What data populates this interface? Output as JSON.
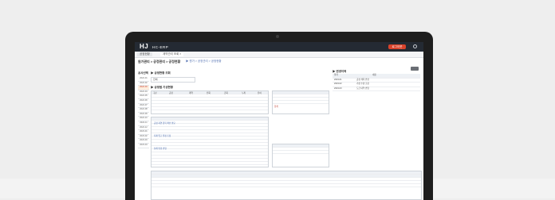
{
  "app": {
    "logo_text": "HJ",
    "logo_accent": "J",
    "system_name": "HC-ERP",
    "nav": [
      "기준정보",
      "인사/급여",
      "영업관리",
      "공사",
      "구매/자재",
      "원가관리",
      "공통",
      "시스템"
    ],
    "active_nav_index": 5,
    "user_button": "로그아웃"
  },
  "tabs": [
    "공정현황",
    "계약관리 조회 ×"
  ],
  "page": {
    "title": "원가관리 > 공정관리 > 공정현황",
    "breadcrumb": "▶ 원가 > 공정관리 > 공정현황"
  },
  "left_panel": {
    "header": "공사선택",
    "items": [
      "2022-01",
      "2022-02",
      "2022-03",
      "2022-04",
      "2022-05",
      "2022-06",
      "2022-07",
      "2022-08",
      "2022-09",
      "2022-10",
      "2022-11",
      "2022-12",
      "2023-01",
      "2023-02",
      "2023-03",
      "2023-04"
    ],
    "selected_index": 2
  },
  "main": {
    "section_title": "▶ 공정현황 조회",
    "filter_value": "전체",
    "sub_title": "▶ 공정별 기성현황",
    "grid_headers": [
      "구분",
      "공정",
      "계약",
      "전회",
      "금회",
      "누계",
      "잔여"
    ],
    "summary_label": "합계",
    "notes": [
      "공정 지연 항목 확인 필요",
      "자재 입고 일정 조정",
      "설계 변경 반영"
    ]
  },
  "right_panel": {
    "header": "▶ 변경이력",
    "columns": [
      "일자",
      "내용"
    ],
    "rows": [
      {
        "date": "2023-01",
        "text": "공정 계획 변경"
      },
      {
        "date": "2023-02",
        "text": "기성 수량 조정"
      },
      {
        "date": "2023-03",
        "text": "도급 내역 반영"
      }
    ]
  },
  "colors": {
    "topbar": "#242a33",
    "accent": "#d9432b",
    "selected_row": "#ffeede",
    "laptop_bezel": "#1e1e1e",
    "background": "#eeeeee"
  },
  "icons": [
    "power-icon",
    "camera-dot"
  ]
}
